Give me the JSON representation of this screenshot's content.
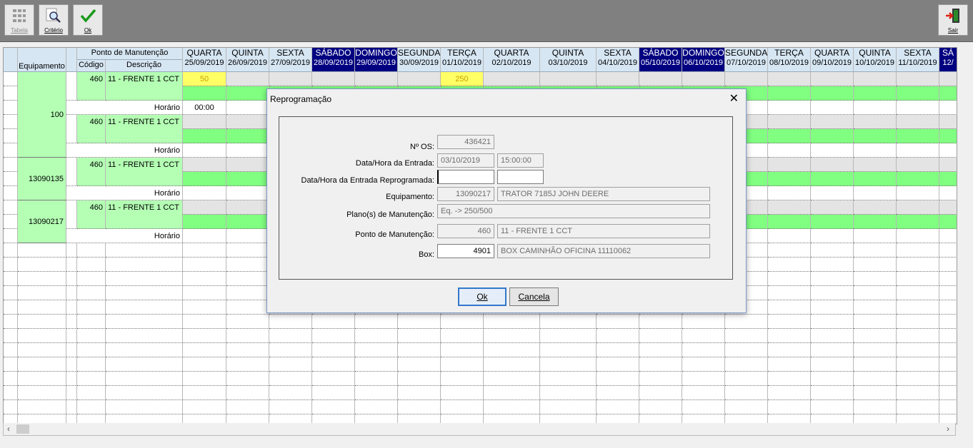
{
  "toolbar": {
    "tabela": "Tabela",
    "criterio": "Critério",
    "ok": "Ok",
    "sair": "Sair"
  },
  "grid": {
    "header": {
      "equipamento": "Equipamento",
      "ponto": "Ponto de Manutenção",
      "codigo": "Código",
      "descricao": "Descrição"
    },
    "days": [
      {
        "dow": "QUARTA",
        "date": "25/09/2019",
        "dark": false
      },
      {
        "dow": "QUINTA",
        "date": "26/09/2019",
        "dark": false
      },
      {
        "dow": "SEXTA",
        "date": "27/09/2019",
        "dark": false
      },
      {
        "dow": "SÁBADO",
        "date": "28/09/2019",
        "dark": true
      },
      {
        "dow": "DOMINGO",
        "date": "29/09/2019",
        "dark": true
      },
      {
        "dow": "SEGUNDA",
        "date": "30/09/2019",
        "dark": false
      },
      {
        "dow": "TERÇA",
        "date": "01/10/2019",
        "dark": false
      },
      {
        "dow": "QUARTA",
        "date": "02/10/2019",
        "dark": false
      },
      {
        "dow": "QUINTA",
        "date": "03/10/2019",
        "dark": false
      },
      {
        "dow": "SEXTA",
        "date": "04/10/2019",
        "dark": false
      },
      {
        "dow": "SÁBADO",
        "date": "05/10/2019",
        "dark": true
      },
      {
        "dow": "DOMINGO",
        "date": "06/10/2019",
        "dark": true
      },
      {
        "dow": "SEGUNDA",
        "date": "07/10/2019",
        "dark": false
      },
      {
        "dow": "TERÇA",
        "date": "08/10/2019",
        "dark": false
      },
      {
        "dow": "QUARTA",
        "date": "09/10/2019",
        "dark": false
      },
      {
        "dow": "QUINTA",
        "date": "10/10/2019",
        "dark": false
      },
      {
        "dow": "SEXTA",
        "date": "11/10/2019",
        "dark": false
      },
      {
        "dow": "SÁ",
        "date": "12/",
        "dark": true
      }
    ],
    "equipments": [
      "100",
      "13090135",
      "13090217"
    ],
    "points": [
      {
        "codigo": "460",
        "descricao": "11 - FRENTE 1 CCT"
      },
      {
        "codigo": "460",
        "descricao": "11 - FRENTE 1 CCT"
      },
      {
        "codigo": "460",
        "descricao": "11 - FRENTE 1 CCT"
      },
      {
        "codigo": "460",
        "descricao": "11 - FRENTE 1 CCT"
      }
    ],
    "horario_label": "Horário",
    "cell_values": {
      "v50": "50",
      "v250": "250",
      "time": "00:00"
    }
  },
  "dialog": {
    "title": "Reprogramação",
    "labels": {
      "os": "Nº OS:",
      "entrada": "Data/Hora da Entrada:",
      "reprog": "Data/Hora da Entrada Reprogramada:",
      "equip": "Equipamento:",
      "plano": "Plano(s) de Manutenção:",
      "ponto": "Ponto de Manutenção:",
      "box": "Box:"
    },
    "values": {
      "os": "436421",
      "entrada_data": "03/10/2019",
      "entrada_hora": "15:00:00",
      "reprog_data": "",
      "reprog_hora": "",
      "equip_code": "13090217",
      "equip_name": "TRATOR 7185J JOHN DEERE",
      "plano": "Eq. -> 250/500",
      "ponto_code": "460",
      "ponto_name": "11 - FRENTE 1 CCT",
      "box_code": "4901",
      "box_name": "BOX CAMINHÃO OFICINA 11110062"
    },
    "ok": "Ok",
    "cancel": "Cancela"
  }
}
